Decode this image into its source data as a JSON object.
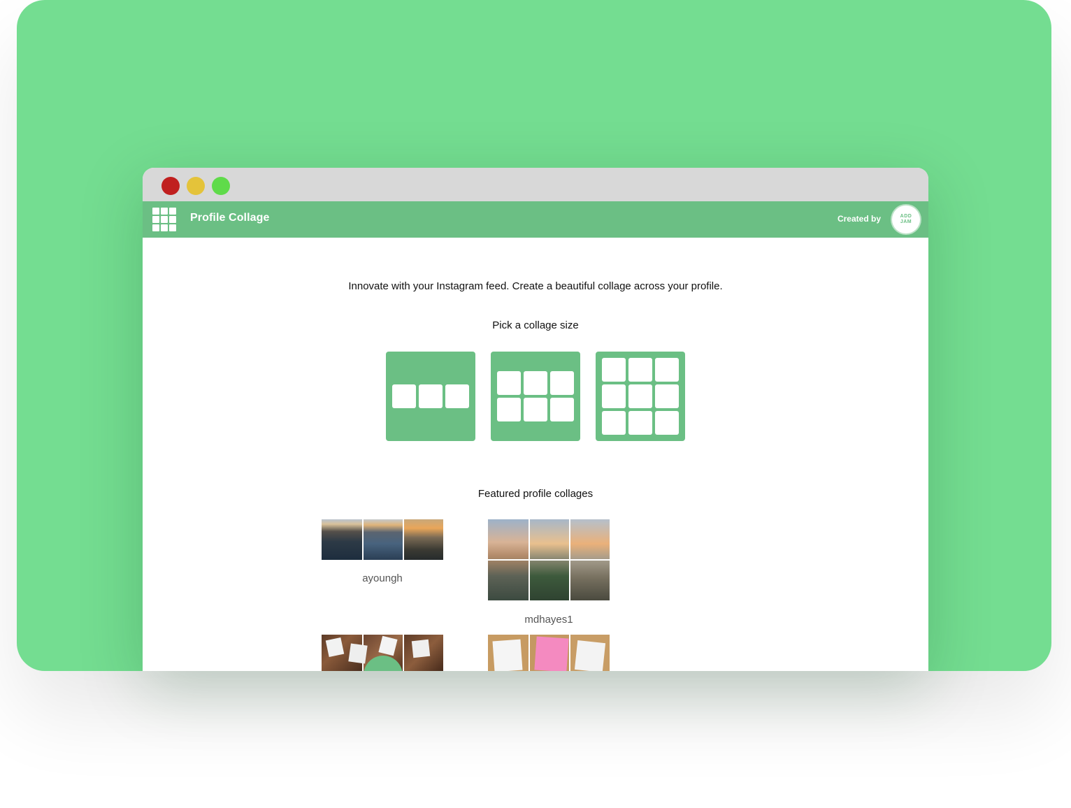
{
  "app": {
    "title": "Profile Collage",
    "created_by": "Created by",
    "badge_text": "ADD JAM"
  },
  "window_controls": {
    "close": "#c0201f",
    "minimize": "#e4c33a",
    "maximize": "#5fdb4a"
  },
  "main": {
    "tagline": "Innovate with your Instagram feed. Create a beautiful collage across your profile.",
    "pick_heading": "Pick a collage size",
    "sizes": [
      {
        "name": "1x3",
        "rows": 1,
        "cols": 3
      },
      {
        "name": "2x3",
        "rows": 2,
        "cols": 3
      },
      {
        "name": "3x3",
        "rows": 3,
        "cols": 3
      }
    ],
    "featured_heading": "Featured profile collages",
    "featured": [
      {
        "username": "ayoungh",
        "rows": 1,
        "cols": 3
      },
      {
        "username": "mdhayes1",
        "rows": 2,
        "cols": 3
      },
      {
        "username": "",
        "rows": 1,
        "cols": 3
      },
      {
        "username": "",
        "rows": 1,
        "cols": 3
      }
    ]
  },
  "colors": {
    "backdrop": "#74dd91",
    "accent": "#6bbf84",
    "titlebar": "#d8d8d8"
  },
  "icons": [
    "grid-logo-icon",
    "add-jam-badge-icon"
  ]
}
